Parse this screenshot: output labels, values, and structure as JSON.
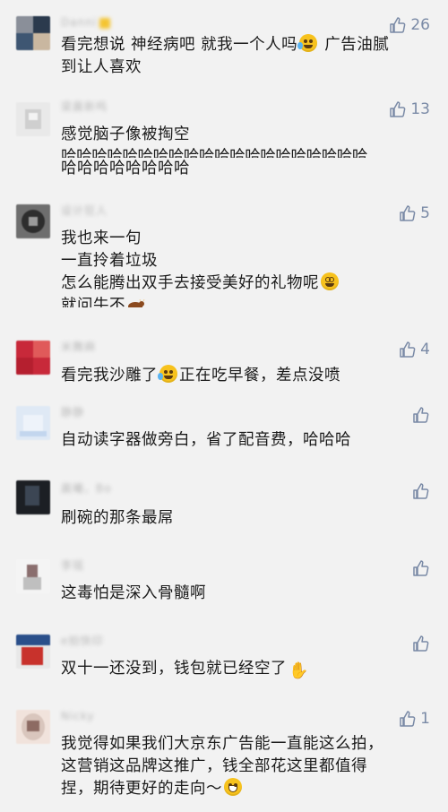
{
  "comments": [
    {
      "name": "Danni",
      "likes": "26",
      "lines": [
        "看完想说 神经病吧 就我一个人吗",
        "到让人喜欢"
      ],
      "line1_suffix": " 广告油腻",
      "emoji": "laugh-tears-emoji",
      "avatar": {
        "colors": [
          "#8a8f99",
          "#2b3a4d",
          "#c9b7a0",
          "#3e5672"
        ]
      }
    },
    {
      "name": "梁晨新鸣",
      "likes": "13",
      "lines": [
        "感觉脑子像被掏空",
        "哈哈哈哈哈哈哈哈哈哈哈哈哈哈哈哈哈哈哈哈",
        "哈哈哈哈哈哈哈哈"
      ],
      "avatar": {
        "colors": [
          "#e8e8e8",
          "#d5d5d5",
          "#c4c4c4",
          "#efefef"
        ]
      }
    },
    {
      "name": "设计狂人",
      "likes": "5",
      "lines": [
        "我也来一句",
        "一直拎着垃圾",
        "怎么能腾出双手去接受美好的礼物呢",
        "就问牛不"
      ],
      "emoji": "dizzy-face-emoji",
      "avatar": {
        "colors": [
          "#6e6e6e",
          "#2d2d2d",
          "#9a9a9a",
          "#4b4b4b"
        ]
      }
    },
    {
      "name": "米舞麻",
      "likes": "4",
      "lines": [
        "看完我沙雕了",
        "正在吃早餐，差点没喷"
      ],
      "emoji": "laugh-tears-emoji",
      "avatar": {
        "colors": [
          "#c8293a",
          "#e05a5a",
          "#b51f2f",
          "#f0a0a0"
        ]
      }
    },
    {
      "name": "静静",
      "likes": "",
      "lines": [
        "自动读字器做旁白，省了配音费，哈哈哈"
      ],
      "avatar": {
        "colors": [
          "#dfe9f5",
          "#c3d6ee",
          "#eef3fa",
          "#a9c3e6"
        ]
      }
    },
    {
      "name": "晨曦、Bo",
      "likes": "",
      "lines": [
        "刷碗的那条最屌"
      ],
      "avatar": {
        "colors": [
          "#1c1f24",
          "#2f3640",
          "#0f1114",
          "#3c4654"
        ]
      }
    },
    {
      "name": "李瑶",
      "likes": "",
      "lines": [
        "这毒怕是深入骨髓啊"
      ],
      "avatar": {
        "colors": [
          "#f4f4f4",
          "#bfbfbf",
          "#8a6e6e",
          "#e2e2e2"
        ]
      }
    },
    {
      "name": "e拍快印",
      "likes": "",
      "lines": [
        "双十一还没到，钱包就已经空了"
      ],
      "emoji": "waving-hand-emoji",
      "avatar": {
        "colors": [
          "#2a4f8a",
          "#c8322c",
          "#e8e8e8",
          "#1b3560"
        ]
      }
    },
    {
      "name": "Nicky",
      "likes": "1",
      "lines": [
        "我觉得如果我们大京东广告能一直能这么拍，",
        "这营销这品牌这推广，钱全部花这里都值得",
        "捏，期待更好的走向～"
      ],
      "emoji": "grinning-face-emoji",
      "avatar": {
        "colors": [
          "#d9c6bd",
          "#8d6b63",
          "#f1e3dc",
          "#5b4440"
        ]
      }
    }
  ],
  "icons": {
    "like": "thumbs-up-outline-icon",
    "ox": "ox-emoji"
  },
  "colors": {
    "background": "#f2f2f2",
    "like": "#7a8aa6",
    "text": "#1a1a1a",
    "name": "#b9b9b9"
  }
}
